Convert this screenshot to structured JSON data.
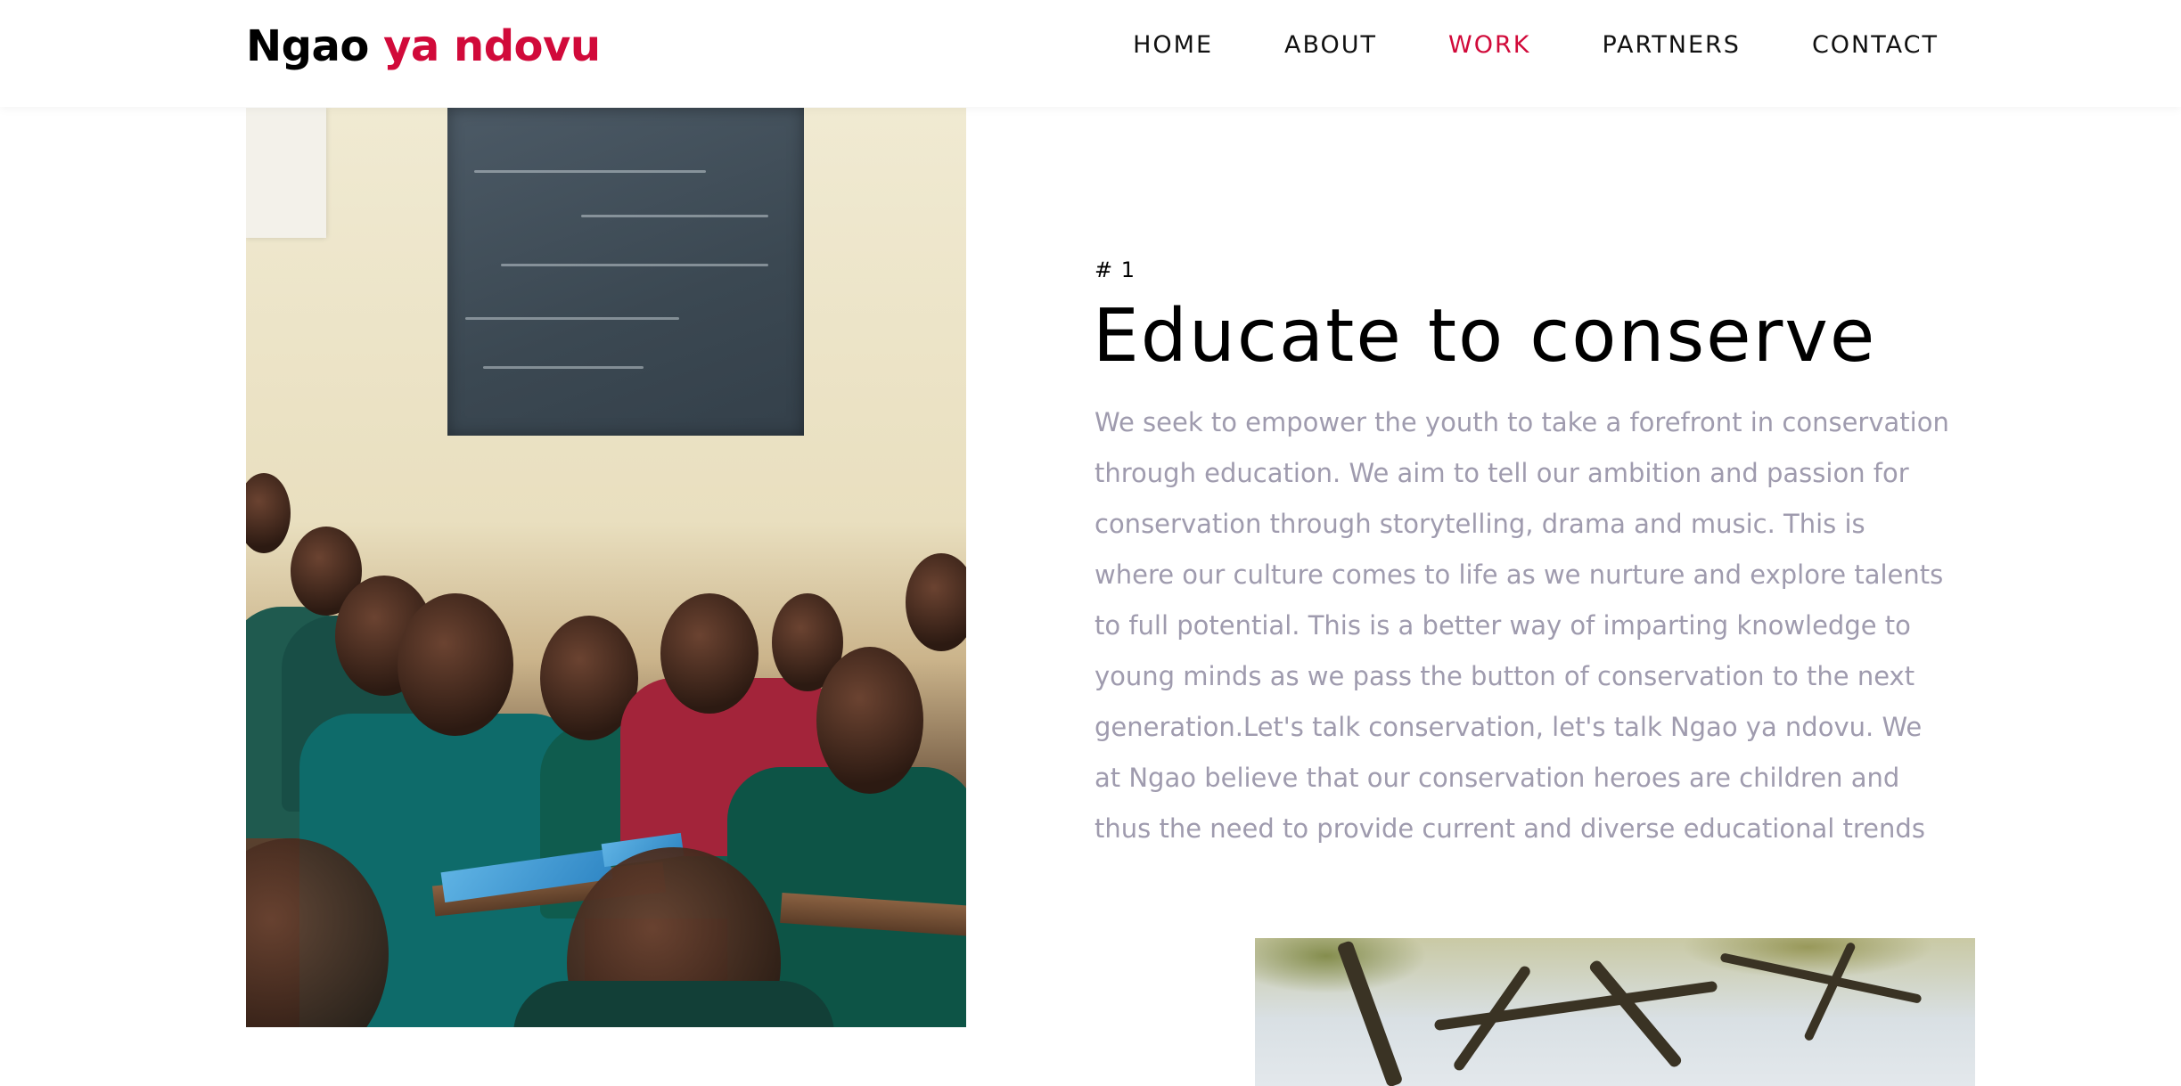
{
  "header": {
    "brand_main": "Ngao",
    "brand_accent": "ya ndovu",
    "accent_color": "#d10a3a",
    "nav": [
      {
        "label": "HOME",
        "active": false
      },
      {
        "label": "ABOUT",
        "active": false
      },
      {
        "label": "WORK",
        "active": true
      },
      {
        "label": "PARTNERS",
        "active": false
      },
      {
        "label": "CONTACT",
        "active": false
      }
    ]
  },
  "section": {
    "number": "# 1",
    "title": "Educate to conserve",
    "body": "We seek to empower the youth to take a forefront in conservation through education. We aim to tell our ambition and passion for conservation through storytelling, drama and music. This is where our culture comes to life as we nurture and explore talents to full potential. This is a better way of imparting knowledge to young minds as we pass the button of conservation to the next generation.Let's talk conservation, let's talk Ngao ya ndovu. We at Ngao believe that our conservation heroes are children and thus the need to provide current and diverse educational trends",
    "body_color": "#9f9bae"
  }
}
